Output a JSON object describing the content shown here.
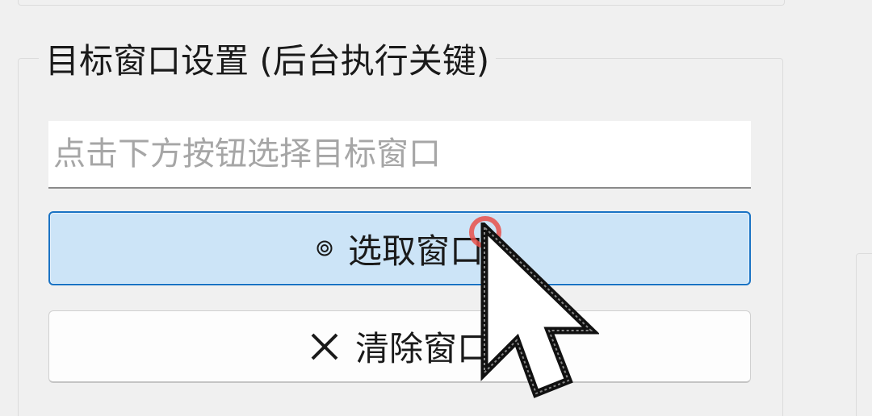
{
  "group": {
    "title": "目标窗口设置 (后台执行关键)"
  },
  "target_input": {
    "value": "",
    "placeholder": "点击下方按钮选择目标窗口"
  },
  "buttons": {
    "select_window": {
      "label": "选取窗口",
      "icon": "target-icon"
    },
    "clear_window": {
      "label": "清除窗口",
      "icon": "close-icon"
    }
  },
  "colors": {
    "primary_button_bg": "#cce4f7",
    "primary_button_border": "#1a73c4",
    "click_indicator": "#e8504a"
  }
}
